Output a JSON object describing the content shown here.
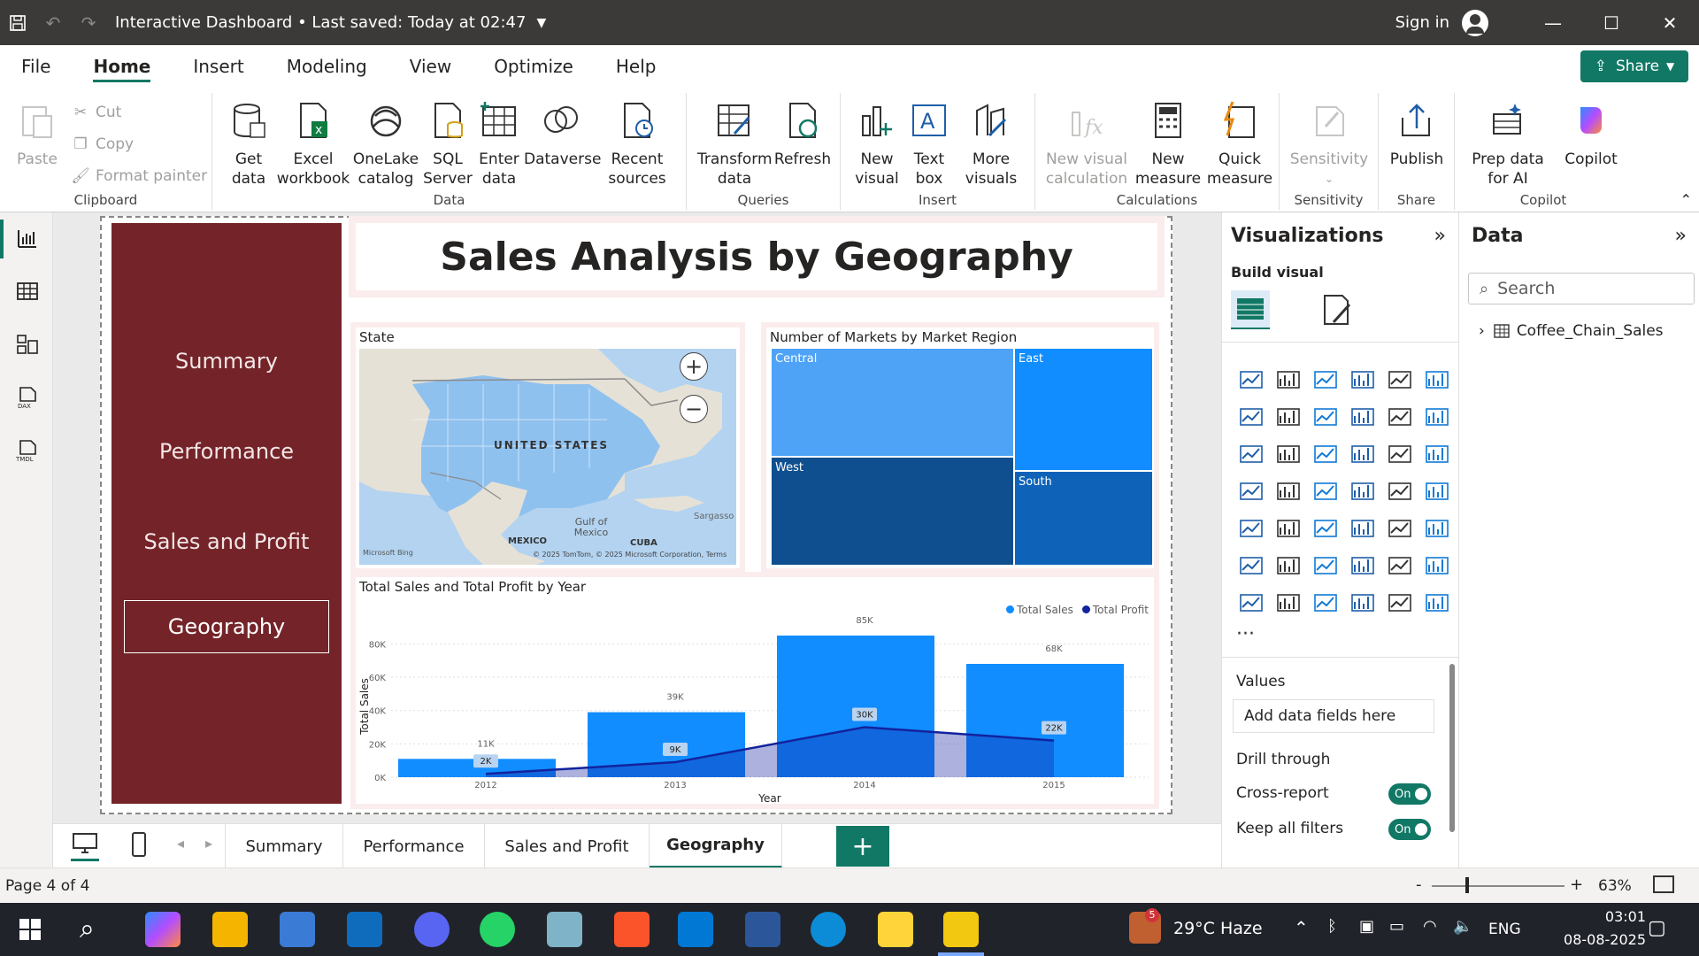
{
  "titlebar": {
    "document": "Interactive Dashboard",
    "saved": "Last saved: Today at 02:47",
    "signin": "Sign in"
  },
  "menu": {
    "tabs": [
      "File",
      "Home",
      "Insert",
      "Modeling",
      "View",
      "Optimize",
      "Help"
    ],
    "share": "Share"
  },
  "ribbon": {
    "clipboard": {
      "paste": "Paste",
      "cut": "Cut",
      "copy": "Copy",
      "format_painter": "Format painter",
      "name": "Clipboard"
    },
    "data": {
      "get_data": "Get data",
      "excel": "Excel workbook",
      "onelake": "OneLake catalog",
      "sql": "SQL Server",
      "enter": "Enter data",
      "dataverse": "Dataverse",
      "recent": "Recent sources",
      "name": "Data"
    },
    "queries": {
      "transform": "Transform data",
      "refresh": "Refresh",
      "name": "Queries"
    },
    "insert": {
      "new_visual": "New visual",
      "text_box": "Text box",
      "more_visuals": "More visuals",
      "name": "Insert"
    },
    "calculations": {
      "new_visual_calc": "New visual calculation",
      "new_measure": "New measure",
      "quick_measure": "Quick measure",
      "name": "Calculations"
    },
    "sensitivity": {
      "sensitivity": "Sensitivity",
      "name": "Sensitivity"
    },
    "share": {
      "publish": "Publish",
      "name": "Share"
    },
    "copilot": {
      "prep": "Prep data for AI",
      "copilot": "Copilot",
      "name": "Copilot"
    }
  },
  "report": {
    "title": "Sales Analysis by Geography",
    "nav": [
      "Summary",
      "Performance",
      "Sales and Profit",
      "Geography"
    ],
    "map": {
      "title": "State",
      "country": "UNITED STATES",
      "gulf": "Gulf of Mexico",
      "mexico": "MEXICO",
      "cuba": "CUBA",
      "sargasso": "Sargasso",
      "bing": "Microsoft Bing",
      "credit": "© 2025 TomTom, © 2025 Microsoft Corporation, Terms"
    },
    "treemap": {
      "title": "Number of Markets by Market Region",
      "cells": [
        {
          "label": "Central",
          "color": "#4ea3f7"
        },
        {
          "label": "East",
          "color": "#118dff"
        },
        {
          "label": "West",
          "color": "#0f4f8f"
        },
        {
          "label": "South",
          "color": "#0e63b8"
        }
      ]
    }
  },
  "chart_data": {
    "type": "bar",
    "title": "Total Sales and Total Profit by Year",
    "xlabel": "Year",
    "ylabel": "Total Sales",
    "categories": [
      "2012",
      "2013",
      "2014",
      "2015"
    ],
    "series": [
      {
        "name": "Total Sales",
        "values": [
          11000,
          39000,
          85000,
          68000
        ],
        "labels": [
          "11K",
          "39K",
          "85K",
          "68K"
        ],
        "color": "#118dff"
      },
      {
        "name": "Total Profit",
        "values": [
          2000,
          9000,
          30000,
          22000
        ],
        "labels": [
          "2K",
          "9K",
          "30K",
          "22K"
        ],
        "color": "#12239e"
      }
    ],
    "yticks": [
      "0K",
      "20K",
      "40K",
      "60K",
      "80K"
    ],
    "ylim": [
      0,
      85000
    ],
    "legend": "top-right"
  },
  "viz": {
    "title": "Visualizations",
    "build": "Build visual",
    "values": "Values",
    "add_fields": "Add data fields here",
    "drill": "Drill through",
    "cross": "Cross-report",
    "keep": "Keep all filters",
    "on": "On"
  },
  "data_panel": {
    "title": "Data",
    "search": "Search",
    "table": "Coffee_Chain_Sales"
  },
  "pages": {
    "tabs": [
      "Summary",
      "Performance",
      "Sales and Profit",
      "Geography"
    ],
    "add": "+"
  },
  "status": {
    "page": "Page 4 of 4",
    "zoom": "63%"
  },
  "taskbar": {
    "weather": "29°C  Haze",
    "lang": "ENG",
    "time": "03:01",
    "date": "08-08-2025",
    "badge": "5"
  }
}
